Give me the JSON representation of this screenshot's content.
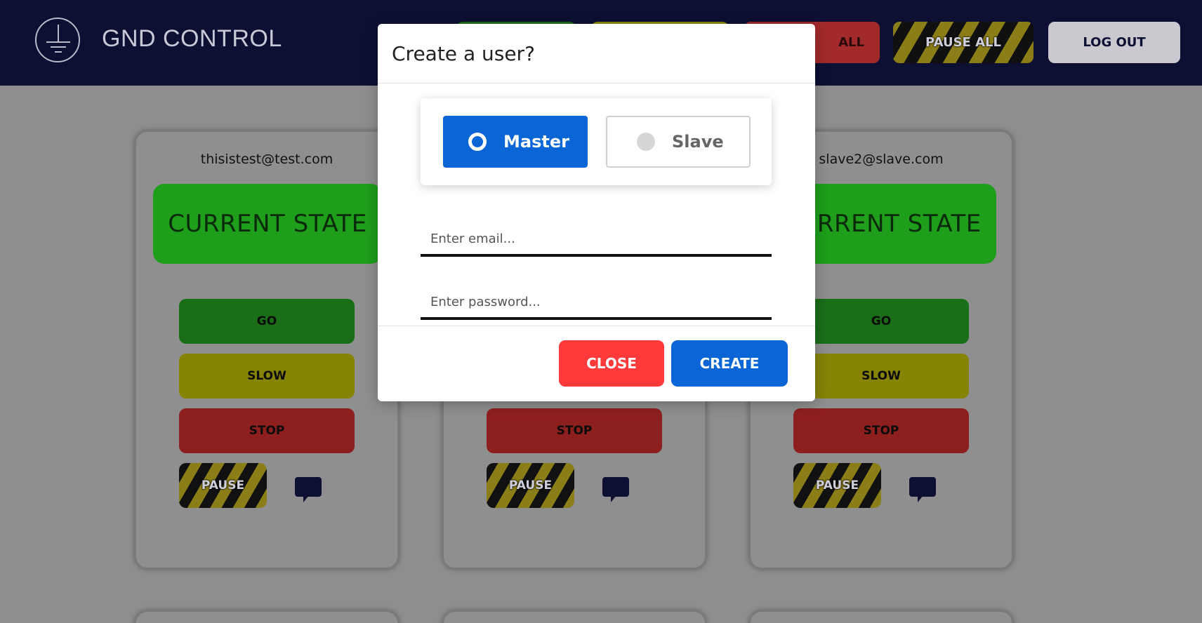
{
  "header": {
    "app_title": "GND CONTROL",
    "stop_all_label": "ALL",
    "pause_all_label": "PAUSE ALL",
    "logout_label": "LOG OUT"
  },
  "cards": [
    {
      "email": "thisistest@test.com",
      "state_label": "CURRENT STATE",
      "go_label": "GO",
      "slow_label": "SLOW",
      "stop_label": "STOP",
      "pause_label": "PAUSE"
    },
    {
      "email": "",
      "state_label": "",
      "go_label": "",
      "slow_label": "",
      "stop_label": "STOP",
      "pause_label": "PAUSE"
    },
    {
      "email": "slave2@slave.com",
      "state_label": "CURRENT STATE",
      "go_label": "GO",
      "slow_label": "SLOW",
      "stop_label": "STOP",
      "pause_label": "PAUSE"
    }
  ],
  "modal": {
    "title": "Create a user?",
    "roles": [
      {
        "label": "Master",
        "selected": true
      },
      {
        "label": "Slave",
        "selected": false
      }
    ],
    "email_placeholder": "Enter email...",
    "password_placeholder": "Enter password...",
    "close_label": "CLOSE",
    "create_label": "CREATE"
  },
  "colors": {
    "header_bg": "#0d0f33",
    "accent_blue": "#0a66d6",
    "close_red": "#ff3a3a"
  }
}
